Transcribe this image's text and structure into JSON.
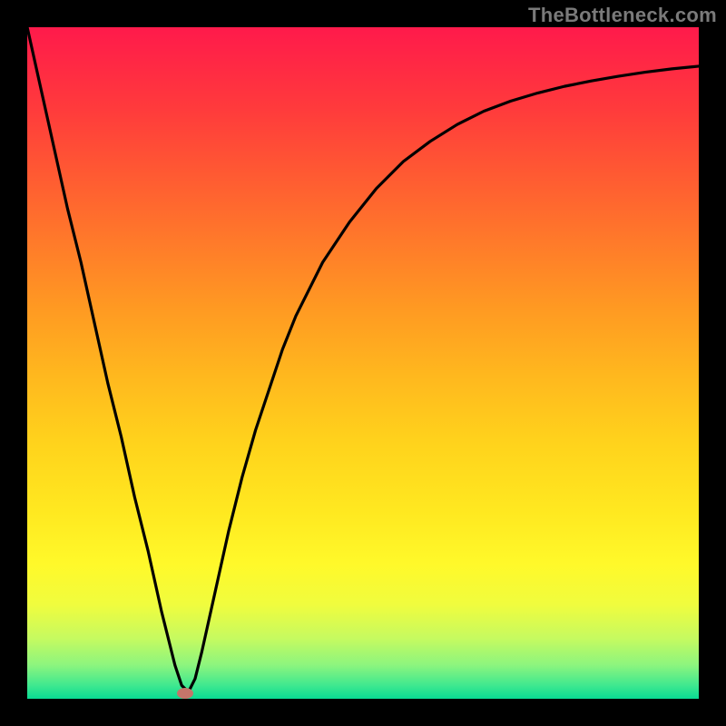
{
  "watermark": "TheBottleneck.com",
  "chart_data": {
    "type": "line",
    "title": "",
    "xlabel": "",
    "ylabel": "",
    "xlim": [
      0,
      100
    ],
    "ylim": [
      0,
      100
    ],
    "series": [
      {
        "name": "curve",
        "x": [
          0,
          2,
          4,
          6,
          8,
          10,
          12,
          14,
          16,
          18,
          20,
          22,
          23,
          24,
          25,
          26,
          28,
          30,
          32,
          34,
          36,
          38,
          40,
          44,
          48,
          52,
          56,
          60,
          64,
          68,
          72,
          76,
          80,
          84,
          88,
          92,
          96,
          100
        ],
        "y": [
          100,
          91,
          82,
          73,
          65,
          56,
          47,
          39,
          30,
          22,
          13,
          5,
          2,
          1,
          3,
          7,
          16,
          25,
          33,
          40,
          46,
          52,
          57,
          65,
          71,
          76,
          80,
          83,
          85.5,
          87.5,
          89,
          90.2,
          91.2,
          92,
          92.7,
          93.3,
          93.8,
          94.2
        ]
      }
    ],
    "marker": {
      "x": 23.5,
      "y": 0.8
    }
  },
  "colors": {
    "curve": "#000000",
    "marker": "#c5756a"
  }
}
